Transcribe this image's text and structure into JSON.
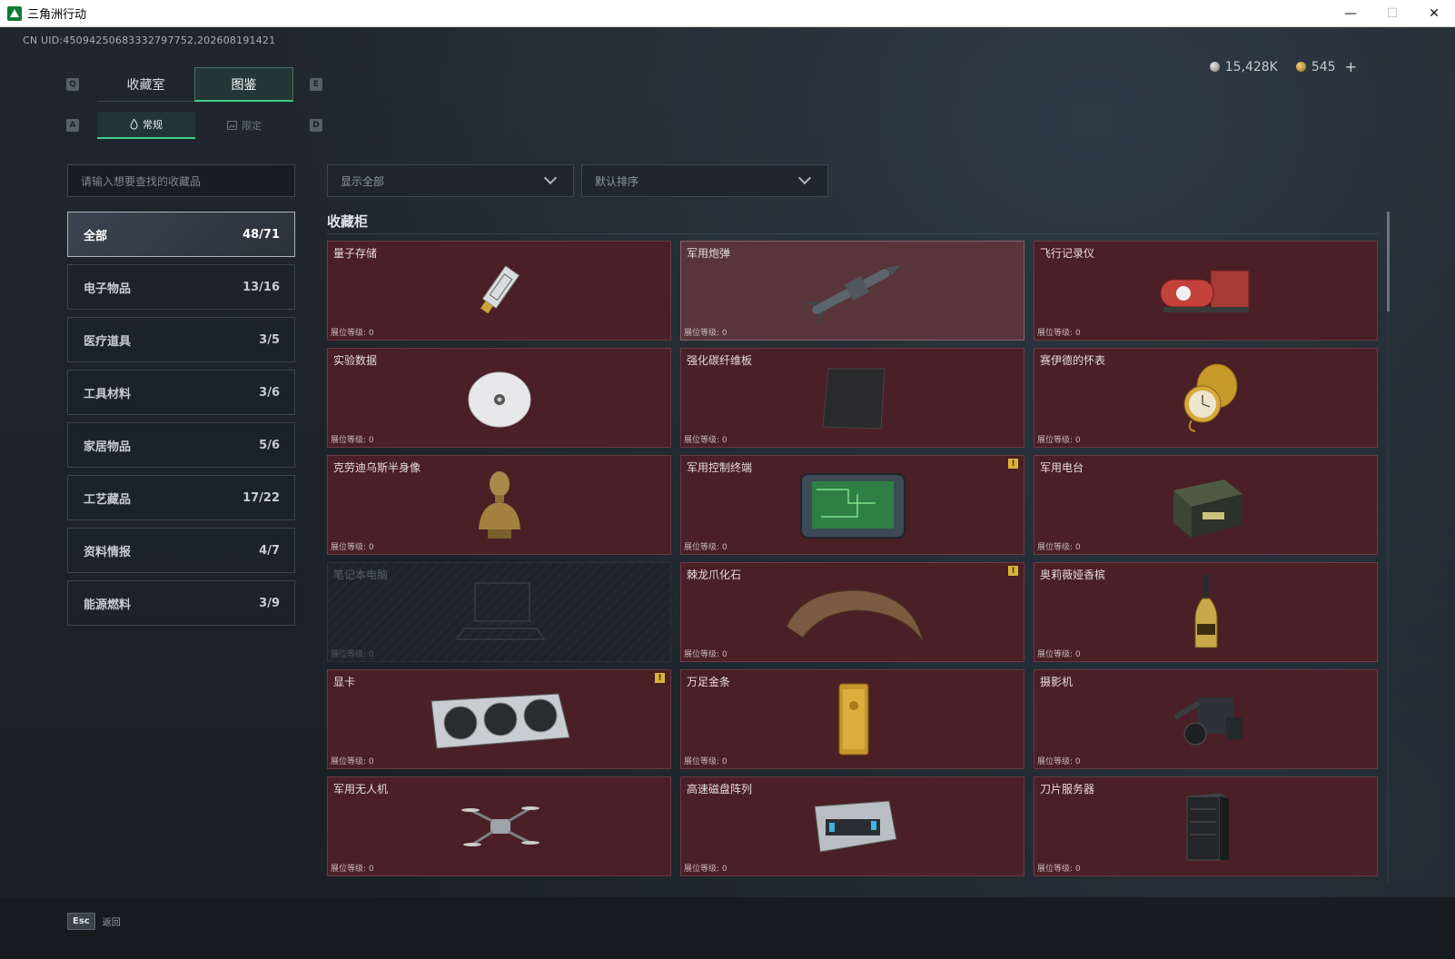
{
  "window": {
    "title": "三角洲行动",
    "minimize": "—",
    "maximize": "☐",
    "close": "✕"
  },
  "uid": "CN UID:450942506833327977​52,202608191421",
  "currency": {
    "silver": "15,428K",
    "gold": "545",
    "add": "+"
  },
  "keys": {
    "q": "Q",
    "e": "E",
    "a": "A",
    "d": "D"
  },
  "tabs": {
    "collection_room": "收藏室",
    "catalog": "图鉴"
  },
  "subtabs": {
    "normal": "常规",
    "limited": "限定"
  },
  "search": {
    "placeholder": "请输入想要查找的收藏品"
  },
  "filters": {
    "show": "显示全部",
    "sort": "默认排序"
  },
  "categories": [
    {
      "label": "全部",
      "count": "48/71"
    },
    {
      "label": "电子物品",
      "count": "13/16"
    },
    {
      "label": "医疗道具",
      "count": "3/5"
    },
    {
      "label": "工具材料",
      "count": "3/6"
    },
    {
      "label": "家居物品",
      "count": "5/6"
    },
    {
      "label": "工艺藏品",
      "count": "17/22"
    },
    {
      "label": "资料情报",
      "count": "4/7"
    },
    {
      "label": "能源燃料",
      "count": "3/9"
    }
  ],
  "section_title": "收藏柜",
  "items": [
    {
      "name": "量子存储",
      "level": "展位等级: 0",
      "icon": "usb-drive-icon"
    },
    {
      "name": "军用炮弹",
      "level": "展位等级: 0",
      "icon": "missile-icon"
    },
    {
      "name": "飞行记录仪",
      "level": "展位等级: 0",
      "icon": "flight-recorder-icon"
    },
    {
      "name": "实验数据",
      "level": "展位等级: 0",
      "icon": "disc-icon"
    },
    {
      "name": "强化碳纤维板",
      "level": "展位等级: 0",
      "icon": "carbon-plate-icon"
    },
    {
      "name": "赛伊德的怀表",
      "level": "展位等级: 0",
      "icon": "pocket-watch-icon"
    },
    {
      "name": "克劳迪乌斯半身像",
      "level": "展位等级: 0",
      "icon": "bust-icon"
    },
    {
      "name": "军用控制终端",
      "level": "展位等级: 0",
      "icon": "control-terminal-icon",
      "warn": "!"
    },
    {
      "name": "军用电台",
      "level": "展位等级: 0",
      "icon": "radio-icon"
    },
    {
      "name": "笔记本电脑",
      "level": "展位等级: 0",
      "icon": "laptop-icon"
    },
    {
      "name": "棘龙爪化石",
      "level": "展位等级: 0",
      "icon": "claw-fossil-icon",
      "warn": "!"
    },
    {
      "name": "奥莉薇娅香槟",
      "level": "展位等级: 0",
      "icon": "champagne-icon"
    },
    {
      "name": "显卡",
      "level": "展位等级: 0",
      "icon": "gpu-icon",
      "warn": "!"
    },
    {
      "name": "万足金条",
      "level": "展位等级: 0",
      "icon": "gold-bar-icon"
    },
    {
      "name": "摄影机",
      "level": "展位等级: 0",
      "icon": "camera-icon"
    },
    {
      "name": "军用无人机",
      "level": "展位等级: 0",
      "icon": "drone-icon"
    },
    {
      "name": "高速磁盘阵列",
      "level": "展位等级: 0",
      "icon": "disk-array-icon"
    },
    {
      "name": "刀片服务器",
      "level": "展位等级: 0",
      "icon": "blade-server-icon"
    }
  ],
  "footer": {
    "esc": "Esc",
    "back": "返回"
  }
}
